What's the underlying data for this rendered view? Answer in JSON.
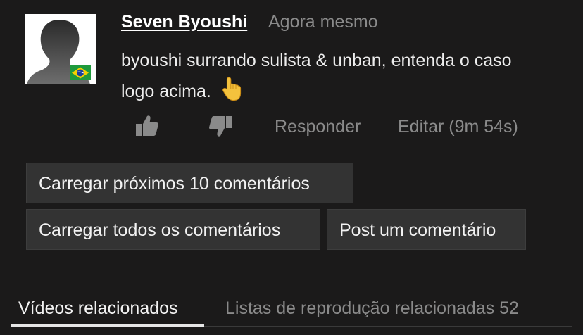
{
  "comment": {
    "username": "Seven Byoushi",
    "timestamp": "Agora mesmo",
    "text": "byoushi surrando sulista & unban, entenda o caso logo acima.",
    "emoji_icon": "pointing-up-hand-icon",
    "avatar_icon": "user-silhouette-icon",
    "flag_icon": "brazil-flag-icon"
  },
  "actions": {
    "like_icon": "thumbs-up-icon",
    "dislike_icon": "thumbs-down-icon",
    "reply_label": "Responder",
    "edit_label": "Editar (9m 54s)"
  },
  "buttons": {
    "load_next": "Carregar próximos 10 comentários",
    "load_all": "Carregar todos os comentários",
    "post_comment": "Post um comentário"
  },
  "tabs": [
    {
      "label": "Vídeos relacionados",
      "active": true
    },
    {
      "label": "Listas de reprodução relacionadas 52",
      "active": false
    }
  ],
  "colors": {
    "background": "#1b1a1a",
    "button_bg": "#333333",
    "muted_text": "#8a8a8a",
    "primary_text": "#ffffff"
  }
}
